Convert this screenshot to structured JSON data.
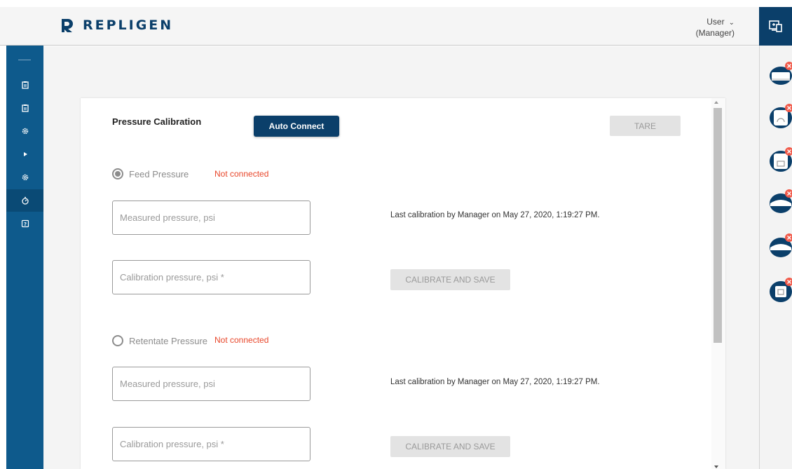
{
  "header": {
    "brand": "REPLIGEN",
    "user_label": "User",
    "user_role": "(Manager)",
    "colors": {
      "brand": "#0b3f6a",
      "nav": "#0e5a8c"
    }
  },
  "nav": {
    "items": [
      {
        "icon": "clipboard-icon"
      },
      {
        "icon": "clipboard-icon"
      },
      {
        "icon": "gear-icon"
      },
      {
        "icon": "play-icon"
      },
      {
        "icon": "gear-icon"
      },
      {
        "icon": "timer-icon",
        "active": true
      },
      {
        "icon": "help-icon"
      }
    ]
  },
  "dock": {
    "devices": [
      "device-1-icon",
      "device-2-icon",
      "device-3-icon",
      "device-4-icon",
      "device-5-icon",
      "device-6-icon"
    ]
  },
  "calibration": {
    "title": "Pressure Calibration",
    "auto_connect": "Auto Connect",
    "tare": "TARE",
    "sections": [
      {
        "label": "Feed Pressure",
        "status": "Not connected",
        "measured_placeholder": "Measured pressure, psi",
        "calibration_placeholder": "Calibration pressure, psi *",
        "last_calibration": "Last calibration by Manager on May 27, 2020, 1:19:27 PM.",
        "calibrate_button": "CALIBRATE AND SAVE"
      },
      {
        "label": "Retentate Pressure",
        "status": "Not connected",
        "measured_placeholder": "Measured pressure, psi",
        "calibration_placeholder": "Calibration pressure, psi *",
        "last_calibration": "Last calibration by Manager on May 27, 2020, 1:19:27 PM.",
        "calibrate_button": "CALIBRATE AND SAVE"
      }
    ]
  }
}
